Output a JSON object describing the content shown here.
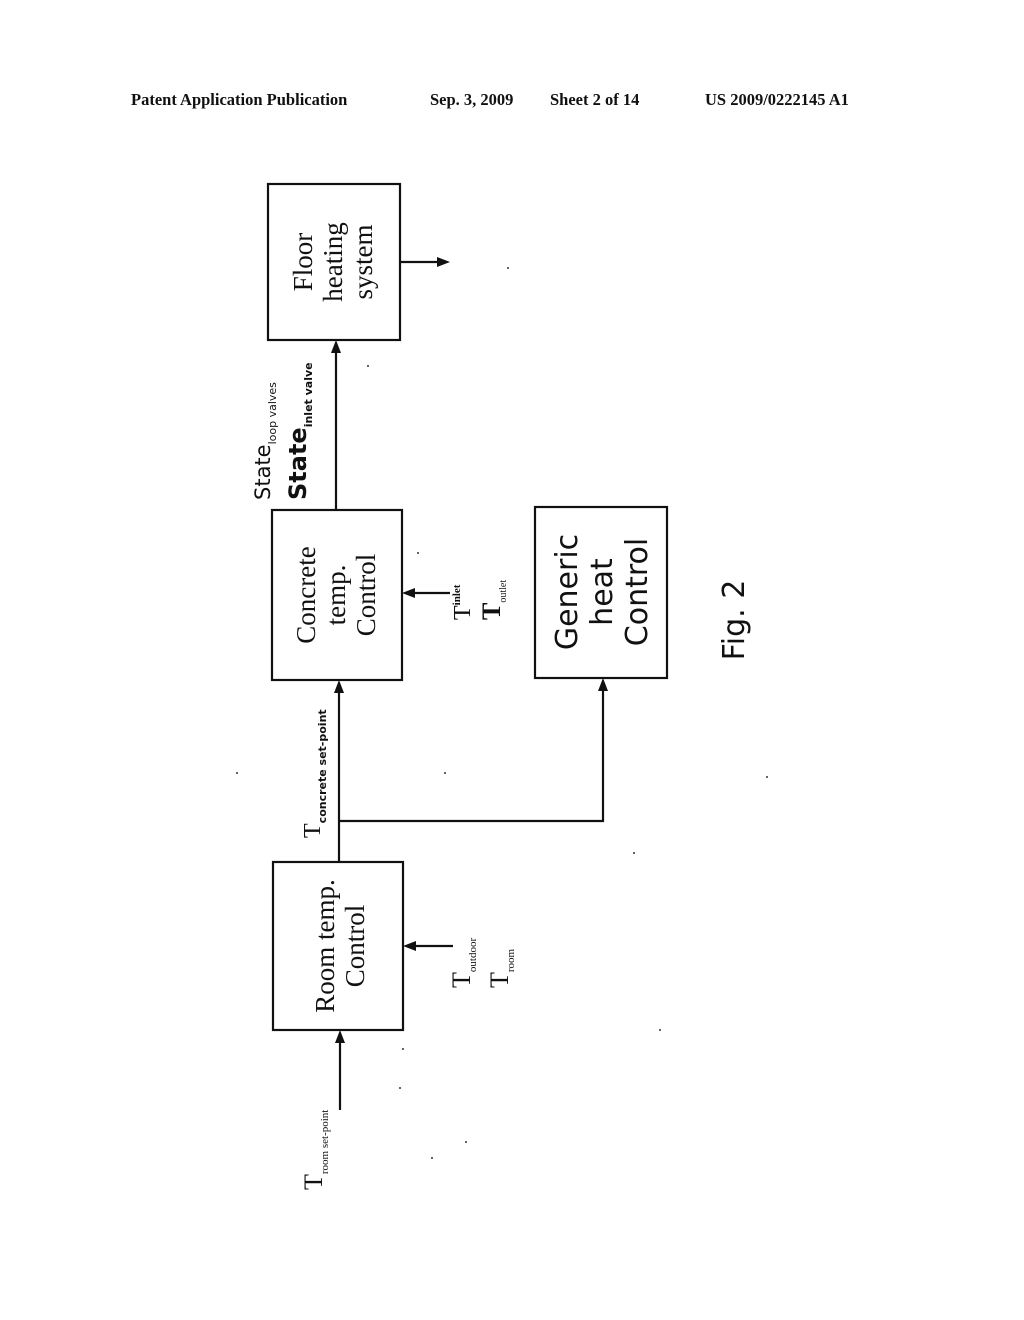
{
  "header": {
    "publication": "Patent Application Publication",
    "date": "Sep. 3, 2009",
    "sheet": "Sheet 2 of 14",
    "number": "US 2009/0222145 A1"
  },
  "diagram": {
    "blocks": {
      "floor": [
        "Floor",
        "heating",
        "system"
      ],
      "concrete": [
        "Concrete",
        "temp.",
        "Control"
      ],
      "generic": [
        "Generic",
        "heat",
        "Control"
      ],
      "room": [
        "Room temp.",
        "Control"
      ]
    },
    "signals": {
      "state_loop": {
        "main": "State",
        "sub": "loop valves"
      },
      "state_inlet": {
        "main": "State",
        "sub": "inlet valve"
      },
      "t_inlet": {
        "main": "T",
        "sub": "inlet"
      },
      "t_outlet": {
        "main": "T",
        "sub": "outlet"
      },
      "t_concrete": {
        "main": "T",
        "sub": "concrete set-point"
      },
      "t_outdoor": {
        "main": "T",
        "sub": "outdoor"
      },
      "t_room": {
        "main": "T",
        "sub": "room"
      },
      "t_room_setpoint": {
        "main": "T",
        "sub": "room set-point"
      }
    },
    "caption": "Fig. 2"
  }
}
